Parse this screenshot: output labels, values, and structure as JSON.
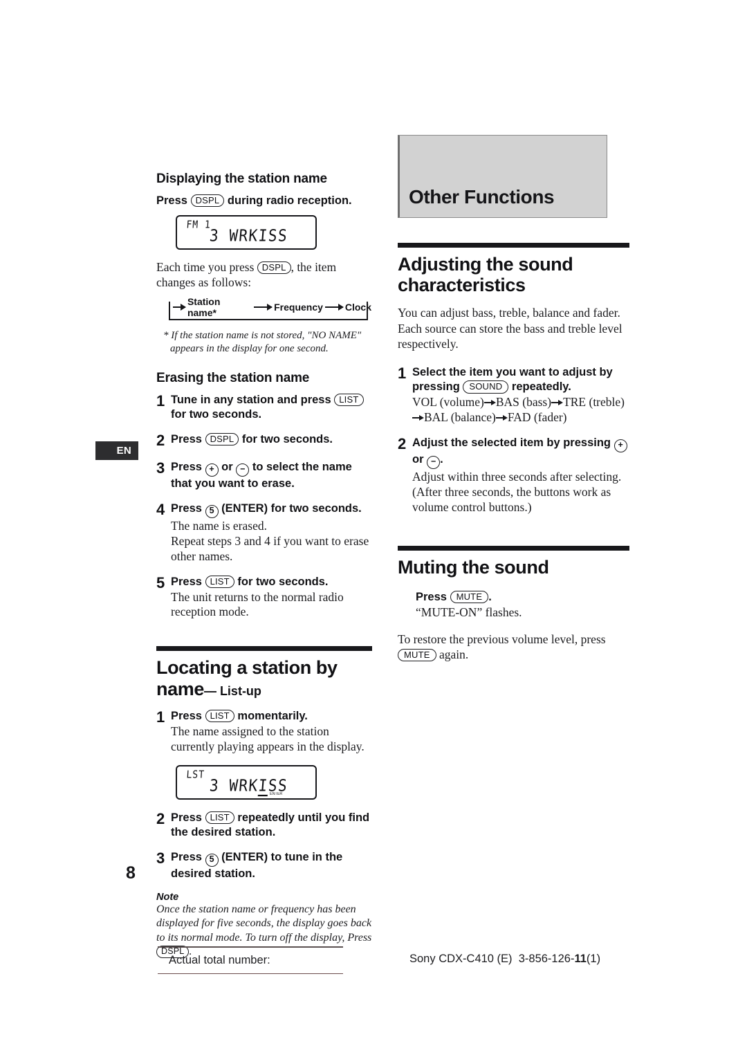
{
  "page": {
    "number": "8",
    "language_tab": "EN"
  },
  "left_column": {
    "displaying": {
      "heading": "Displaying the station name",
      "press_label": "Press",
      "press_button": "DSPL",
      "press_suffix": "during radio reception.",
      "lcd": {
        "small_label": "FM 1",
        "main_text": "3 WRKISS"
      },
      "each_time_pre": "Each time you press",
      "each_time_button": "DSPL",
      "each_time_post": ", the item changes as follows:",
      "flow": [
        "Station name*",
        "Frequency",
        "Clock"
      ],
      "footnote": "* If the station name is not stored, \"NO NAME\" appears in the display for one second."
    },
    "erasing": {
      "heading": "Erasing the station name",
      "steps": [
        {
          "num": "1",
          "title_pre": "Tune in any station and press",
          "title_button": "LIST",
          "title_post": "for two seconds.",
          "desc": ""
        },
        {
          "num": "2",
          "title_pre": "Press",
          "title_button": "DSPL",
          "title_post": "for two seconds.",
          "desc": ""
        },
        {
          "num": "3",
          "title_pre": "Press",
          "title_button": "+",
          "title_mid": "or",
          "title_button2": "−",
          "title_post": "to select the name that you want to erase.",
          "desc": ""
        },
        {
          "num": "4",
          "title_pre": "Press",
          "title_button": "5",
          "title_post": "(ENTER) for two seconds.",
          "desc": "The name is erased.\nRepeat steps 3 and 4 if you want to erase other names."
        },
        {
          "num": "5",
          "title_pre": "Press",
          "title_button": "LIST",
          "title_post": "for two seconds.",
          "desc": "The unit returns to the normal radio reception mode."
        }
      ]
    },
    "locating": {
      "heading_line1": "Locating a station by",
      "heading_line2": "name",
      "heading_dash": "— List-up",
      "steps": [
        {
          "num": "1",
          "title_pre": "Press",
          "title_button": "LIST",
          "title_post": "momentarily.",
          "desc": "The name assigned to the station currently playing appears in the display."
        },
        {
          "num": "2",
          "title_pre": "Press",
          "title_button": "LIST",
          "title_post": "repeatedly until you find the desired station.",
          "desc": ""
        },
        {
          "num": "3",
          "title_pre": "Press",
          "title_button": "5",
          "title_post": "(ENTER) to tune in the desired station.",
          "desc": ""
        }
      ],
      "lcd": {
        "small_label": "LST",
        "main_text_a": "3 WRK",
        "main_text_u": "I",
        "main_text_b": "SS",
        "enter_label": "ENTER"
      },
      "note_heading": "Note",
      "note_body_pre": "Once the station name or frequency has been displayed for five seconds, the display goes back to its normal mode. To turn off the display, Press",
      "note_button": "DSPL",
      "note_body_post": "."
    }
  },
  "right_column": {
    "chapter_title": "Other Functions",
    "adjusting": {
      "heading": "Adjusting the sound characteristics",
      "intro": "You can adjust bass, treble, balance and fader. Each source can store the bass and treble level respectively.",
      "steps": [
        {
          "num": "1",
          "title_pre": "Select the item you want to adjust by pressing",
          "title_button": "SOUND",
          "title_post": "repeatedly.",
          "desc_items": [
            "VOL (volume)",
            "BAS (bass)",
            "TRE (treble)",
            "BAL (balance)",
            "FAD (fader)"
          ]
        },
        {
          "num": "2",
          "title_pre": "Adjust the selected item by pressing",
          "title_button": "+",
          "title_mid": "or",
          "title_button2": "−",
          "title_post": ".",
          "desc": "Adjust within three seconds after selecting. (After three seconds, the buttons work as volume control buttons.)"
        }
      ]
    },
    "muting": {
      "heading": "Muting the sound",
      "press_label": "Press",
      "press_button": "MUTE",
      "press_suffix": ".",
      "flashes_text": "“MUTE-ON” flashes.",
      "restore_pre": "To restore the previous volume level, press",
      "restore_button": "MUTE",
      "restore_post": "again."
    }
  },
  "footer": {
    "left_text": "Actual total number:",
    "right_brand": "Sony CDX-C410 (E)",
    "right_code_pre": "3-856-126-",
    "right_code_bold": "11",
    "right_code_post": "(1)"
  },
  "colors": {
    "chapter_box_bg": "#d2d2d2",
    "rule_bar": "#18181b",
    "en_tab_bg": "#2d2d2f",
    "footer_rule": "#5a5050"
  }
}
